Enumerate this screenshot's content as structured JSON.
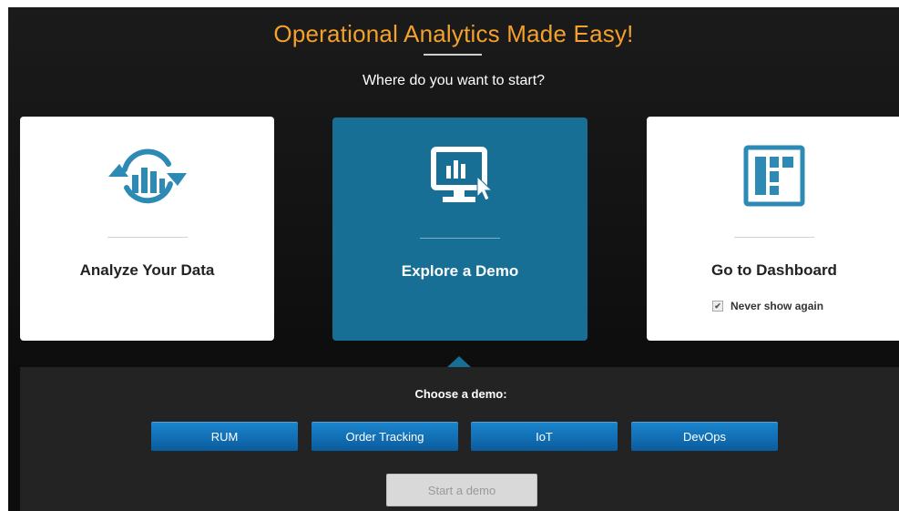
{
  "header": {
    "title": "Operational Analytics Made Easy!",
    "subtitle": "Where do you want to start?"
  },
  "cards": [
    {
      "id": "analyze",
      "label": "Analyze Your Data",
      "icon": "refresh-chart-icon"
    },
    {
      "id": "demo",
      "label": "Explore a Demo",
      "icon": "monitor-chart-cursor-icon"
    },
    {
      "id": "dashboard",
      "label": "Go to Dashboard",
      "icon": "dashboard-layout-icon"
    }
  ],
  "never_show": {
    "label": "Never show again",
    "checked": true
  },
  "demo_panel": {
    "title": "Choose a demo:",
    "options": [
      "RUM",
      "Order Tracking",
      "IoT",
      "DevOps"
    ],
    "start_label": "Start a demo"
  },
  "colors": {
    "accent_orange": "#f3a02c",
    "selected_card": "#176f96",
    "button_blue": "#1a86cf",
    "background": "#161616"
  }
}
